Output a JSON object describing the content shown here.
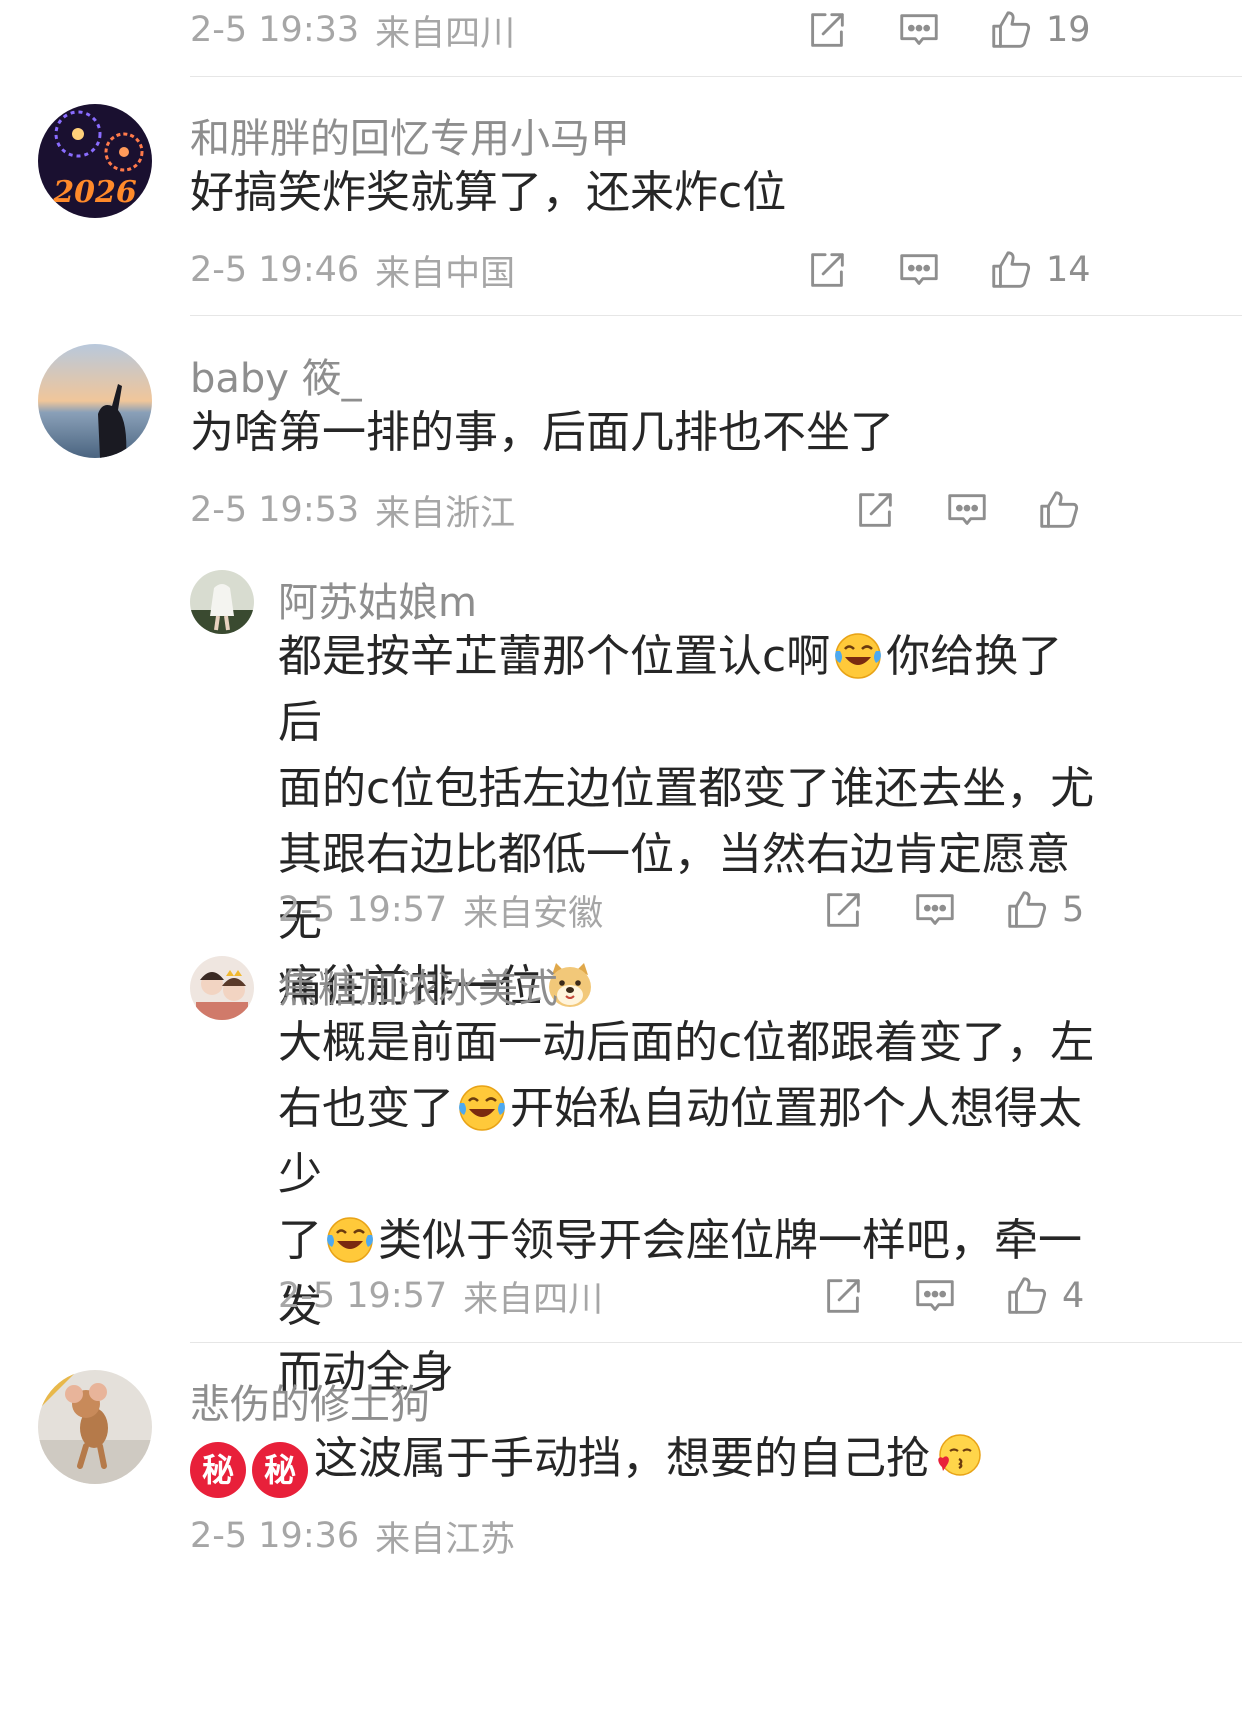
{
  "comments": [
    {
      "time": "2-5 19:33",
      "location": "来自四川",
      "likes": "19"
    },
    {
      "username": "和胖胖的回忆专用小马甲",
      "text": "好搞笑炸奖就算了，还来炸c位",
      "time": "2-5 19:46",
      "location": "来自中国",
      "likes": "14",
      "avatar_text": "2026"
    },
    {
      "username": "baby 筱_",
      "text": "为啥第一排的事，后面几排也不坐了",
      "time": "2-5 19:53",
      "location": "来自浙江",
      "likes": "",
      "replies": [
        {
          "username": "阿苏姑娘m",
          "lines": [
            "都是按辛芷蕾那个位置认c啊",
            "你给换了后",
            "面的c位包括左边位置都变了谁还去坐，尤",
            "其跟右边比都低一位，当然右边肯定愿意 无",
            "痛往前排一位"
          ],
          "time": "2-5 19:57",
          "location": "来自安徽",
          "likes": "5"
        },
        {
          "username": "焦糖加浓冰美式",
          "lines": [
            "大概是前面一动后面的c位都跟着变了，左",
            "右也变了",
            "开始私自动位置那个人想得太少",
            "了",
            "类似于领导开会座位牌一样吧，牵一发",
            "而动全身"
          ],
          "time": "2-5 19:57",
          "location": "来自四川",
          "likes": "4"
        }
      ]
    },
    {
      "username": "悲伤的修土狗",
      "secret_badge": "秘",
      "text": "这波属于手动挡，想要的自己抢",
      "time": "2-5 19:36",
      "location": "来自江苏"
    }
  ],
  "icons": {
    "share": "share-icon",
    "comment": "comment-icon",
    "like": "like-icon",
    "laugh_cry": "laugh-cry-emoji",
    "doge": "doge-emoji",
    "kiss": "kiss-emoji"
  },
  "colors": {
    "meta": "#a6a6a6",
    "icon": "#8e8e8e",
    "text": "#262626",
    "secret_badge": "#e8203a"
  }
}
